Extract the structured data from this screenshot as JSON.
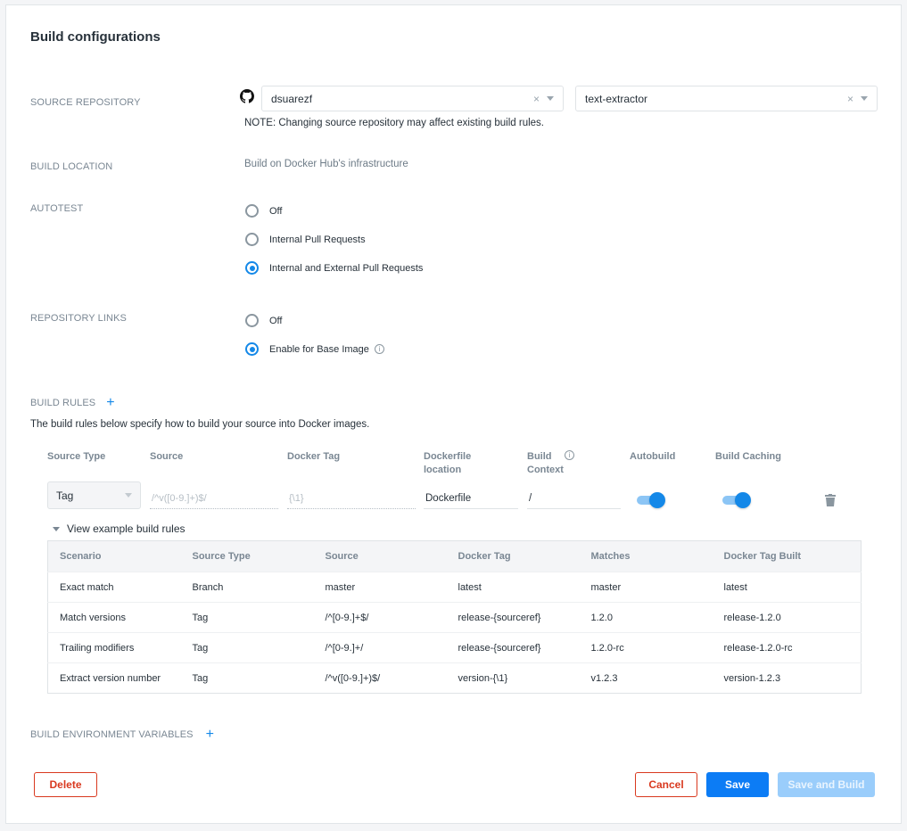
{
  "page": {
    "title": "Build configurations"
  },
  "source_repository": {
    "label": "SOURCE REPOSITORY",
    "provider_icon": "github-icon",
    "organization": "dsuarezf",
    "repository": "text-extractor",
    "clear_glyph": "×",
    "note": "NOTE: Changing source repository may affect existing build rules."
  },
  "build_location": {
    "label": "BUILD LOCATION",
    "value": "Build on Docker Hub's infrastructure"
  },
  "autotest": {
    "label": "AUTOTEST",
    "options": [
      {
        "label": "Off",
        "selected": false
      },
      {
        "label": "Internal Pull Requests",
        "selected": false
      },
      {
        "label": "Internal and External Pull Requests",
        "selected": true
      }
    ]
  },
  "repository_links": {
    "label": "REPOSITORY LINKS",
    "options": [
      {
        "label": "Off",
        "selected": false
      },
      {
        "label": "Enable for Base Image",
        "selected": true
      }
    ],
    "info_glyph": "i"
  },
  "build_rules": {
    "label": "BUILD RULES",
    "add_glyph": "+",
    "description": "The build rules below specify how to build your source into Docker images.",
    "columns": {
      "source_type": "Source Type",
      "source": "Source",
      "docker_tag": "Docker Tag",
      "dockerfile_location_1": "Dockerfile",
      "dockerfile_location_2": "location",
      "build_context_1": "Build",
      "build_context_2": "Context",
      "autobuild": "Autobuild",
      "build_caching": "Build Caching"
    },
    "rule": {
      "source_type": "Tag",
      "source_placeholder": "/^v([0-9.]+)$/",
      "docker_tag_placeholder": "{\\1}",
      "dockerfile_location": "Dockerfile",
      "build_context": "/",
      "autobuild": true,
      "build_caching": true
    },
    "examples_toggle": "View example build rules",
    "examples": {
      "headers": [
        "Scenario",
        "Source Type",
        "Source",
        "Docker Tag",
        "Matches",
        "Docker Tag Built"
      ],
      "rows": [
        [
          "Exact match",
          "Branch",
          "master",
          "latest",
          "master",
          "latest"
        ],
        [
          "Match versions",
          "Tag",
          "/^[0-9.]+$/",
          "release-{sourceref}",
          "1.2.0",
          "release-1.2.0"
        ],
        [
          "Trailing modifiers",
          "Tag",
          "/^[0-9.]+/",
          "release-{sourceref}",
          "1.2.0-rc",
          "release-1.2.0-rc"
        ],
        [
          "Extract version number",
          "Tag",
          "/^v([0-9.]+)$/",
          "version-{\\1}",
          "v1.2.3",
          "version-1.2.3"
        ]
      ]
    }
  },
  "env_vars": {
    "label": "BUILD ENVIRONMENT VARIABLES",
    "add_glyph": "+"
  },
  "actions": {
    "delete": "Delete",
    "cancel": "Cancel",
    "save": "Save",
    "save_and_build": "Save and Build"
  },
  "colors": {
    "accent": "#1488e8",
    "primary_button": "#0c7cf5",
    "danger": "#d9391f",
    "disabled_button": "#9acdfb"
  }
}
